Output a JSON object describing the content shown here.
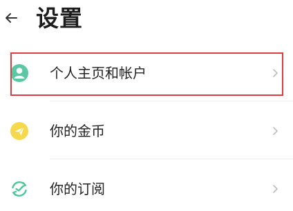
{
  "header": {
    "title": "设置",
    "back_icon": "arrow-left-icon"
  },
  "settings_items": [
    {
      "label": "个人主页和帐户",
      "icon": "user-circle-icon",
      "icon_color": "#5cc8a3",
      "chevron": "chevron-right-icon"
    },
    {
      "label": "你的金币",
      "icon": "coin-paper-plane-icon",
      "icon_color": "#f5d84c",
      "chevron": "chevron-right-icon"
    },
    {
      "label": "你的订阅",
      "icon": "subscription-refresh-icon",
      "icon_color": "#4cc79a",
      "chevron": "chevron-right-icon"
    }
  ],
  "colors": {
    "highlight_border": "#e03a3e",
    "chevron": "#bdbdbd",
    "text": "#222222"
  }
}
